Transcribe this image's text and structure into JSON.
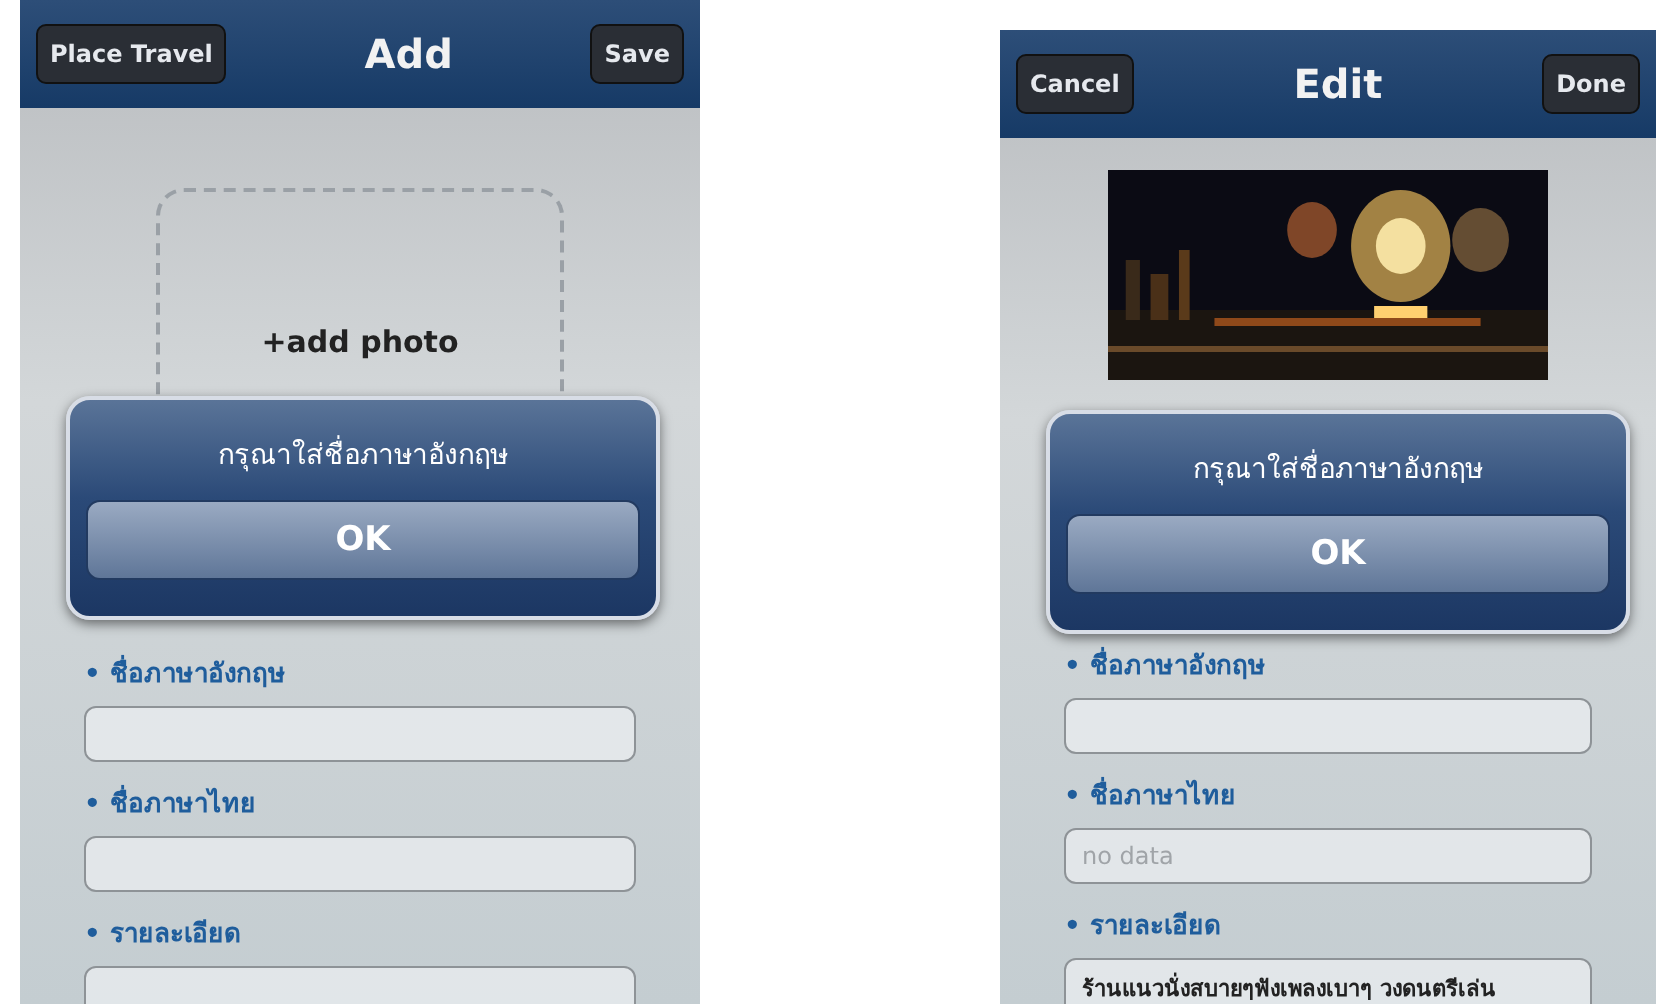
{
  "screens": [
    {
      "nav": {
        "left_button": "Place Travel",
        "title": "Add",
        "right_button": "Save"
      },
      "photo": {
        "kind": "placeholder",
        "label": "+add photo"
      },
      "alert": {
        "message": "กรุณาใส่ชื่อภาษาอังกฤษ",
        "button": "OK"
      },
      "fields": [
        {
          "label": "• ชื่อภาษาอังกฤษ",
          "kind": "line"
        },
        {
          "label": "• ชื่อภาษาไทย",
          "kind": "line"
        },
        {
          "label": "• รายละเอียด",
          "kind": "area"
        }
      ]
    },
    {
      "nav": {
        "left_button": "Cancel",
        "title": "Edit",
        "right_button": "Done"
      },
      "alert": {
        "message": "กรุณาใส่ชื่อภาษาอังกฤษ",
        "button": "OK"
      },
      "fields": [
        {
          "label": "• ชื่อภาษาอังกฤษ",
          "kind": "line"
        },
        {
          "label": "• ชื่อภาษาไทย",
          "kind": "line",
          "placeholder": "no data"
        },
        {
          "label": "• รายละเอียด",
          "kind": "area",
          "value": "ร้านแนวนั่งสบายๆฟังเพลงเบาๆ วงดนตรีเล่น"
        }
      ]
    }
  ]
}
